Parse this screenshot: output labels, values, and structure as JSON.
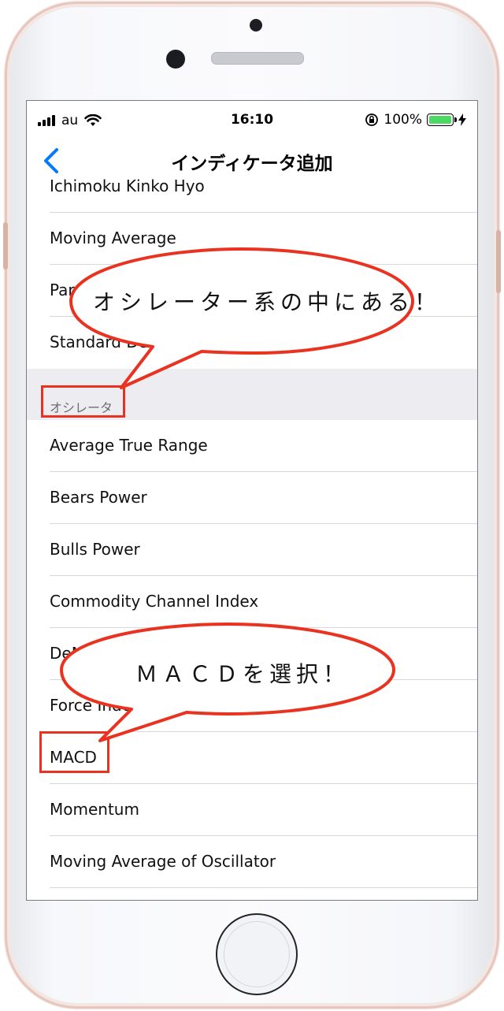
{
  "status_bar": {
    "carrier": "au",
    "time": "16:10",
    "battery_percent": "100%"
  },
  "nav": {
    "title": "インディケータ追加"
  },
  "list": {
    "trend_items": [
      "Ichimoku Kinko Hyo",
      "Moving Average",
      "Par",
      "Standard De"
    ],
    "section_header": "オシレータ",
    "oscillator_items": [
      "Average True Range",
      "Bears Power",
      "Bulls Power",
      "Commodity Channel Index",
      "DeM",
      "Force Inde",
      "MACD",
      "Momentum",
      "Moving Average of Oscillator"
    ]
  },
  "annotations": {
    "bubble1": "オシレーター系の中にある！",
    "bubble2": "ＭＡＣＤを選択！"
  },
  "colors": {
    "accent": "#007aff",
    "annotation_red": "#e9321f",
    "battery_green": "#4cd964",
    "section_bg": "#ececf1"
  }
}
